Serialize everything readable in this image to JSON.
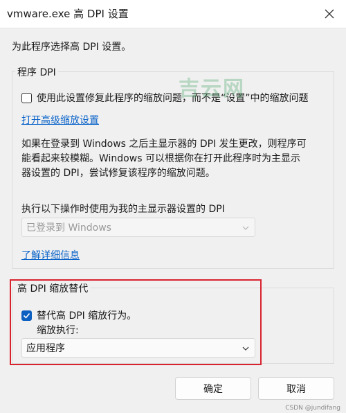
{
  "window": {
    "title": "vmware.exe 高 DPI 设置"
  },
  "intro": "为此程序选择高 DPI 设置。",
  "program_dpi": {
    "title": "程序 DPI",
    "checkbox_label": "使用此设置修复此程序的缩放问题，而不是“设置”中的缩放问题",
    "checkbox_checked": false,
    "link_advanced": "打开高级缩放设置",
    "description_lines": [
      "如果在登录到 Windows 之后主显示器的 DPI 发生更改，则程序可",
      "能看起来较模糊。Windows 可以根据你在打开此程序时为主显示",
      "器设置的 DPI，尝试修复该程序的缩放问题。"
    ],
    "select_label": "执行以下操作时使用为我的主显示器设置的 DPI",
    "select_value": "已登录到 Windows",
    "link_more": "了解详细信息"
  },
  "override": {
    "title": "高 DPI 缩放替代",
    "checkbox_label": "替代高 DPI 缩放行为。",
    "checkbox_checked": true,
    "scaling_label": "缩放执行:",
    "select_value": "应用程序"
  },
  "buttons": {
    "ok": "确定",
    "cancel": "取消"
  },
  "watermark": "吉云网",
  "credit": "CSDN @jundifang",
  "colors": {
    "accent": "#0b5fc0",
    "link": "#0a63c9",
    "highlight": "#d9232f"
  }
}
